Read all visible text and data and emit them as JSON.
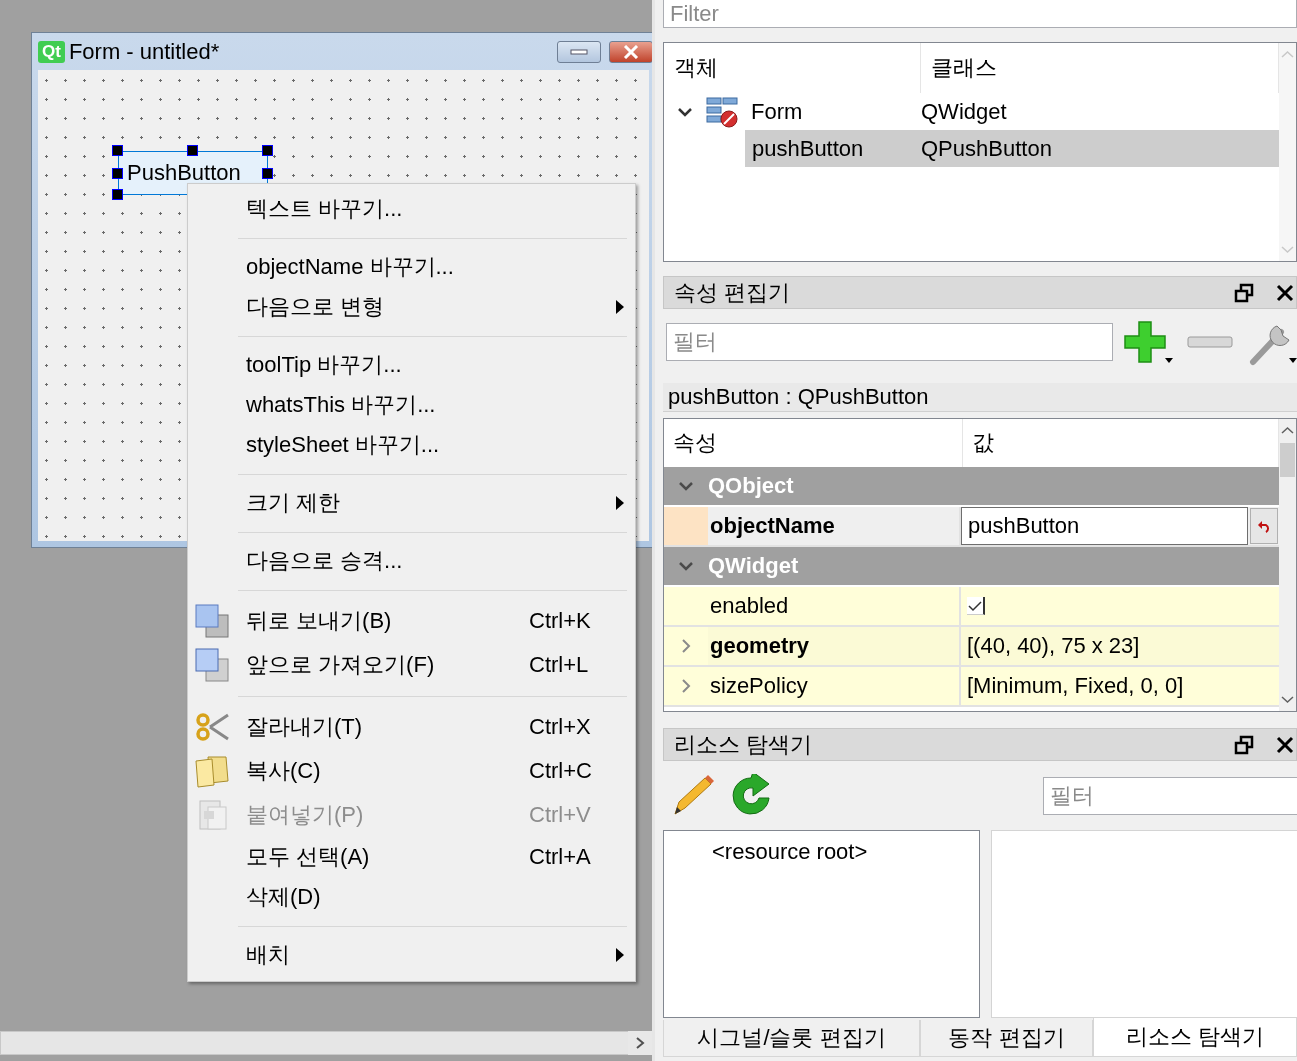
{
  "form_window": {
    "logo": "Qt",
    "title": "Form - untitled*",
    "widget": {
      "label": "PushButton",
      "selected": true
    }
  },
  "context_menu": {
    "items": [
      {
        "kind": "action",
        "label": "텍스트 바꾸기...",
        "disabled": false
      },
      {
        "kind": "separator"
      },
      {
        "kind": "action",
        "label": "objectName 바꾸기...",
        "disabled": false
      },
      {
        "kind": "submenu",
        "label": "다음으로 변형",
        "disabled": false
      },
      {
        "kind": "separator"
      },
      {
        "kind": "action",
        "label": "toolTip 바꾸기...",
        "disabled": false
      },
      {
        "kind": "action",
        "label": "whatsThis 바꾸기...",
        "disabled": false
      },
      {
        "kind": "action",
        "label": "styleSheet 바꾸기...",
        "disabled": false
      },
      {
        "kind": "separator"
      },
      {
        "kind": "submenu",
        "label": "크기 제한",
        "disabled": false
      },
      {
        "kind": "separator"
      },
      {
        "kind": "action",
        "label": "다음으로 승격...",
        "disabled": false
      },
      {
        "kind": "separator"
      },
      {
        "kind": "action",
        "label": "뒤로 보내기(B)",
        "shortcut": "Ctrl+K",
        "disabled": false
      },
      {
        "kind": "action",
        "label": "앞으로 가져오기(F)",
        "shortcut": "Ctrl+L",
        "disabled": false
      },
      {
        "kind": "separator"
      },
      {
        "kind": "action",
        "label": "잘라내기(T)",
        "shortcut": "Ctrl+X",
        "disabled": false
      },
      {
        "kind": "action",
        "label": "복사(C)",
        "shortcut": "Ctrl+C",
        "disabled": false
      },
      {
        "kind": "action",
        "label": "붙여넣기(P)",
        "shortcut": "Ctrl+V",
        "disabled": true
      },
      {
        "kind": "action",
        "label": "모두 선택(A)",
        "shortcut": "Ctrl+A",
        "disabled": false
      },
      {
        "kind": "action",
        "label": "삭제(D)",
        "disabled": false
      },
      {
        "kind": "separator"
      },
      {
        "kind": "submenu",
        "label": "배치",
        "disabled": false
      }
    ]
  },
  "object_inspector": {
    "filter": {
      "placeholder": "Filter"
    },
    "columns": [
      "객체",
      "클래스"
    ],
    "objects": [
      {
        "name": "Form",
        "class": "QWidget",
        "expanded": true,
        "selected": false,
        "children": [
          {
            "name": "pushButton",
            "class": "QPushButton",
            "selected": true
          }
        ]
      }
    ]
  },
  "property_editor": {
    "title": "속성 편집기",
    "filter": {
      "placeholder": "필터"
    },
    "subject": "pushButton : QPushButton",
    "columns": [
      "속성",
      "값"
    ],
    "groups": [
      {
        "name": "QObject",
        "expanded": true,
        "color": "#fde3c4",
        "properties": [
          {
            "kind": "text",
            "name": "objectName",
            "value": "pushButton",
            "modified": true,
            "selected": true
          }
        ]
      },
      {
        "name": "QWidget",
        "expanded": true,
        "color": "#fffed9",
        "properties": [
          {
            "kind": "checkbox",
            "name": "enabled",
            "checked": true,
            "modified": false,
            "selected": false
          },
          {
            "kind": "compound",
            "name": "geometry",
            "value": "[(40, 40), 75 x 23]",
            "expanded": false,
            "modified": true,
            "selected": false
          },
          {
            "kind": "compound",
            "name": "sizePolicy",
            "value": "[Minimum, Fixed, 0, 0]",
            "expanded": false,
            "modified": false,
            "selected": false
          }
        ]
      }
    ]
  },
  "resource_browser": {
    "title": "리소스 탐색기",
    "filter": {
      "placeholder": "필터"
    },
    "root": "<resource root>"
  },
  "bottom_tabs": [
    {
      "label": "시그널/슬롯 편집기",
      "selected": false
    },
    {
      "label": "동작 편집기",
      "selected": false
    },
    {
      "label": "리소스 탐색기",
      "selected": true
    }
  ]
}
